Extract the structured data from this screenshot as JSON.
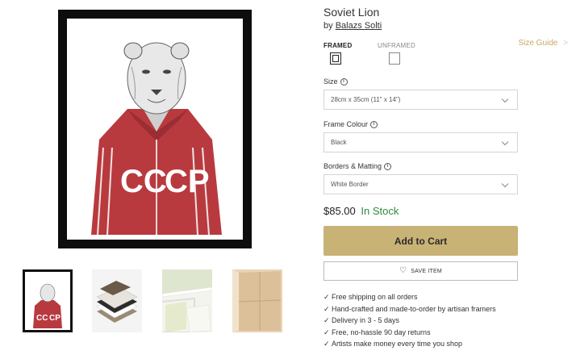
{
  "product": {
    "title": "Soviet Lion",
    "by_prefix": "by",
    "artist": "Balazs Solti"
  },
  "frame_options": {
    "framed_label": "FRAMED",
    "unframed_label": "UNFRAMED",
    "selected": "framed"
  },
  "size_guide": {
    "label": "Size Guide",
    "arrow": ">"
  },
  "fields": {
    "size": {
      "label": "Size",
      "value": "28cm x 35cm (11\" x 14\")"
    },
    "frame_colour": {
      "label": "Frame Colour",
      "value": "Black"
    },
    "borders": {
      "label": "Borders & Matting",
      "value": "White Border"
    }
  },
  "info_icon": "i",
  "artwork_text": {
    "left": "CC",
    "right": "CP"
  },
  "pricing": {
    "price": "$85.00",
    "stock": "In Stock"
  },
  "actions": {
    "add_to_cart": "Add to Cart",
    "save_item": "SAVE ITEM"
  },
  "features": [
    "Free shipping on all orders",
    "Hand-crafted and made-to-order by artisan framers",
    "Delivery in 3 - 5 days",
    "Free, no-hassle 90 day returns",
    "Artists make money every time you shop"
  ],
  "check_glyph": "✓",
  "colors": {
    "accent_gold": "#c8b276",
    "size_guide": "#c9a868",
    "in_stock": "#2e8b3e",
    "frame_black": "#0d0d0d",
    "jacket_red": "#b83a3f"
  }
}
